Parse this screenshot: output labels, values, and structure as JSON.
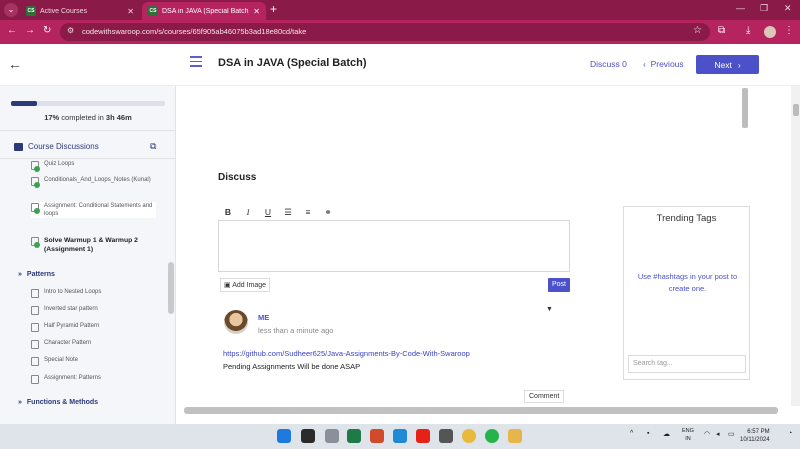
{
  "browser": {
    "tabs": [
      {
        "label": "Active Courses",
        "active": false
      },
      {
        "label": "DSA in JAVA (Special Batch) - Co",
        "active": true
      }
    ],
    "url": "codewithswaroop.com/s/courses/65f905ab46075b3ad18e80cd/take"
  },
  "header": {
    "title": "DSA in JAVA (Special Batch)",
    "discuss_label": "Discuss 0",
    "previous_label": "Previous",
    "next_label": "Next"
  },
  "sidebar": {
    "progress_percent": 17,
    "progress_pct_text": "17%",
    "progress_mid_text": " completed in ",
    "progress_time": "3h 46m",
    "discussions_label": "Course Discussions",
    "items": [
      {
        "label": "Quiz Loops"
      },
      {
        "label": "Conditionals_And_Loops_Notes (Kunal)"
      },
      {
        "label": "Assignment: Conditional Statements and loops"
      },
      {
        "label": "Solve Warmup 1 & Warmup 2 (Assignment 1)"
      }
    ],
    "section_patterns": "Patterns",
    "pattern_items": [
      {
        "label": "Intro to Nested Loops"
      },
      {
        "label": "Inverted star pattern"
      },
      {
        "label": "Half Pyramid Pattern"
      },
      {
        "label": "Character Pattern"
      },
      {
        "label": "Special Note"
      },
      {
        "label": "Assignment: Patterns"
      }
    ],
    "section_functions": "Functions & Methods"
  },
  "discussion": {
    "heading": "Discuss",
    "add_image_label": "Add Image",
    "post_label": "Post",
    "comment": {
      "author": "ME",
      "time": "less than a minute ago",
      "link": "https://github.com/Sudheer625/Java-Assignments-By-Code-With-Swaroop",
      "text": "Pending Assignments Will be done ASAP"
    },
    "comment_button_label": "Comment"
  },
  "trending": {
    "title": "Trending Tags",
    "text_prefix": "Use ",
    "hashtag": "#hashtags",
    "text_suffix": " in your post to create one.",
    "search_placeholder": "Search tag..."
  },
  "taskbar": {
    "lang_top": "ENG",
    "lang_bottom": "IN",
    "time": "6:57 PM",
    "date": "10/11/2024"
  },
  "colors": {
    "accent": "#4c50c9",
    "browser_theme": "#b5245f",
    "sidebar_text": "#2c3a7a"
  }
}
